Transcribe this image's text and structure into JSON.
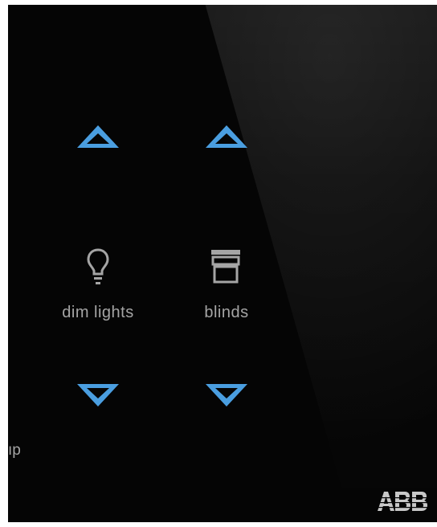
{
  "panel": {
    "colors": {
      "background": "#050505",
      "arrow": "#4a9ee0",
      "label": "#a5a5a5",
      "logo": "#c8c8c8"
    },
    "edge_label": "ıp",
    "brand": "ABB"
  },
  "controls": [
    {
      "label": "dim lights",
      "icon": "lightbulb-icon",
      "up": "chevron-up-icon",
      "down": "chevron-down-icon"
    },
    {
      "label": "blinds",
      "icon": "blinds-icon",
      "up": "chevron-up-icon",
      "down": "chevron-down-icon"
    }
  ]
}
